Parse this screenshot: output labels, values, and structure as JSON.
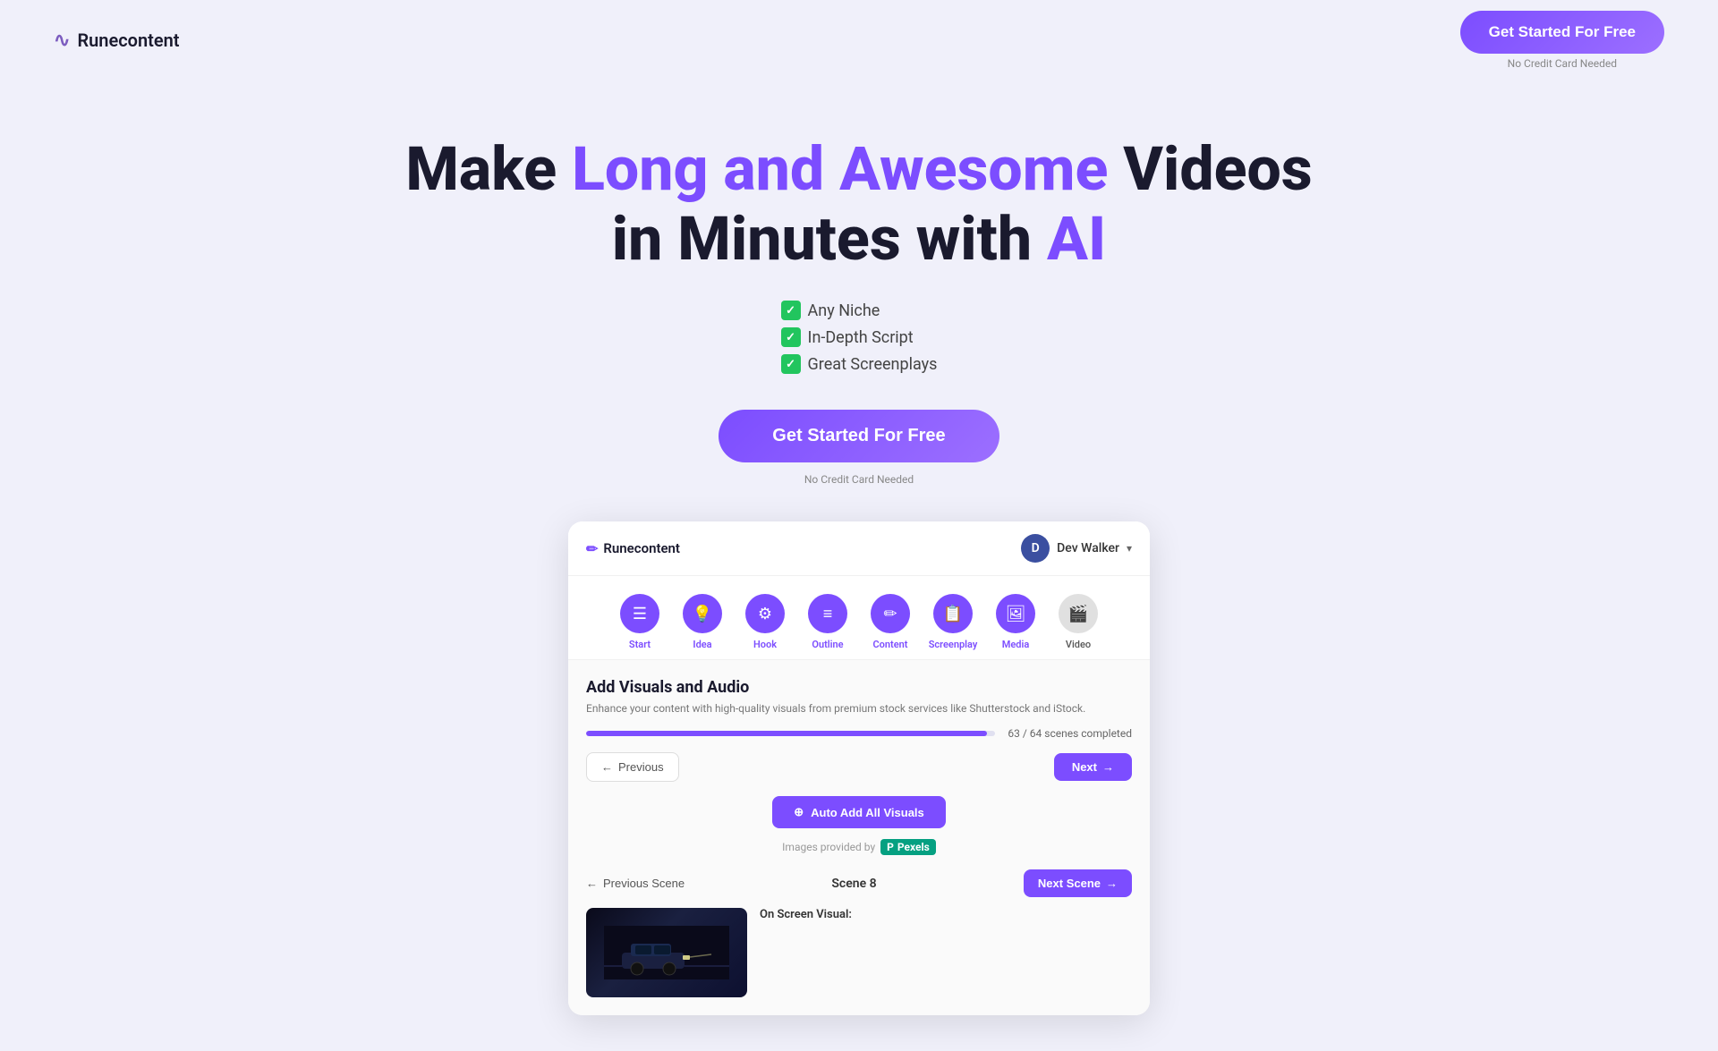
{
  "header": {
    "logo_text": "Runecontent",
    "cta_button": "Get Started For Free",
    "no_card": "No Credit Card Needed"
  },
  "hero": {
    "headline_part1": "Make ",
    "headline_highlight": "Long and Awesome",
    "headline_part2": " Videos",
    "headline_line2_part1": "in Minutes with ",
    "headline_ai": "AI",
    "features": [
      "Any Niche",
      "In-Depth Script",
      "Great Screenplays"
    ],
    "cta_button": "Get Started For Free",
    "no_card": "No Credit Card Needed"
  },
  "mockup": {
    "logo_text": "Runecontent",
    "user": {
      "initial": "D",
      "name": "Dev Walker"
    },
    "steps": [
      {
        "label": "Start",
        "icon": "☰",
        "active": true
      },
      {
        "label": "Idea",
        "icon": "💡",
        "active": true
      },
      {
        "label": "Hook",
        "icon": "🔗",
        "active": true
      },
      {
        "label": "Outline",
        "icon": "≡",
        "active": true
      },
      {
        "label": "Content",
        "icon": "✏️",
        "active": true
      },
      {
        "label": "Screenplay",
        "icon": "✍️",
        "active": true
      },
      {
        "label": "Media",
        "icon": "🖼",
        "active": true
      },
      {
        "label": "Video",
        "icon": "🎬",
        "active": false
      }
    ],
    "main": {
      "title": "Add Visuals and Audio",
      "description": "Enhance your content with high-quality visuals from premium stock services like Shutterstock and iStock.",
      "progress_fill_pct": 98,
      "progress_text": "63 / 64 scenes completed",
      "prev_label": "Previous",
      "next_label": "Next",
      "auto_add_label": "Auto Add All Visuals",
      "images_by": "Images provided by",
      "pexels": "P Pexels",
      "scene_number": "Scene 8",
      "prev_scene_label": "Previous Scene",
      "next_scene_label": "Next Scene",
      "on_screen_label": "On Screen Visual:"
    }
  }
}
